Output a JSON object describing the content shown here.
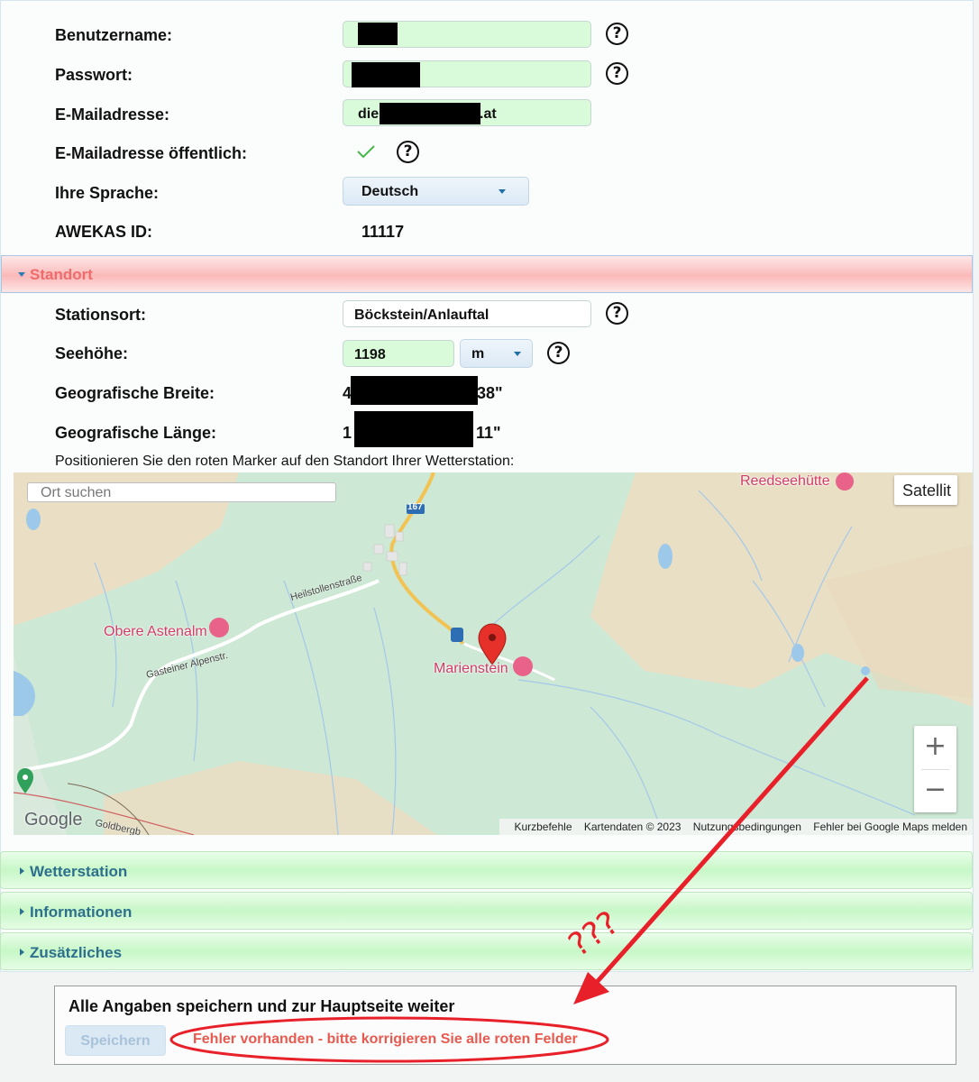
{
  "account": {
    "username_label": "Benutzername:",
    "password_label": "Passwort:",
    "email_label": "E-Mailadresse:",
    "email_prefix": "die",
    "email_suffix": ".at",
    "email_public_label": "E-Mailadresse öffentlich:",
    "email_public_checked": true,
    "language_label": "Ihre Sprache:",
    "language_value": "Deutsch",
    "awekas_id_label": "AWEKAS ID:",
    "awekas_id_value": "11117",
    "help_glyph": "?"
  },
  "standort": {
    "header": "Standort",
    "station_label": "Stationsort:",
    "station_value": "Böckstein/Anlauftal",
    "altitude_label": "Seehöhe:",
    "altitude_value": "1198",
    "altitude_unit": "m",
    "lat_label": "Geografische Breite:",
    "lat_prefix": "4",
    "lat_suffix": "38\"",
    "lon_label": "Geografische Länge:",
    "lon_prefix": "1",
    "lon_suffix": "11\"",
    "marker_instruction": "Positionieren Sie den roten Marker auf den Standort Ihrer Wetterstation:"
  },
  "map": {
    "search_placeholder": "Ort suchen",
    "satellite_button": "Satellit",
    "zoom_in": "+",
    "zoom_out": "−",
    "google_logo": "Google",
    "places": {
      "reedseehuette": "Reedseehütte",
      "obere_astenalm": "Obere Astenalm",
      "marienstein": "Marienstein"
    },
    "roads": {
      "heilstollenstrasse": "Heilstollenstraße",
      "gasteiner_alpenstr": "Gasteiner Alpenstr.",
      "road_number": "167",
      "goldberg": "Goldbergb"
    },
    "attribution": [
      "Kurzbefehle",
      "Kartendaten © 2023",
      "Nutzungsbedingungen",
      "Fehler bei Google Maps melden"
    ]
  },
  "sections": {
    "wetterstation": "Wetterstation",
    "informationen": "Informationen",
    "zusaetzliches": "Zusätzliches"
  },
  "save": {
    "title": "Alle Angaben speichern und zur Hauptseite weiter",
    "button": "Speichern",
    "error": "Fehler vorhanden - bitte korrigieren Sie alle roten Felder"
  },
  "annotation": {
    "question_marks": "???",
    "color": "#e8202a"
  }
}
